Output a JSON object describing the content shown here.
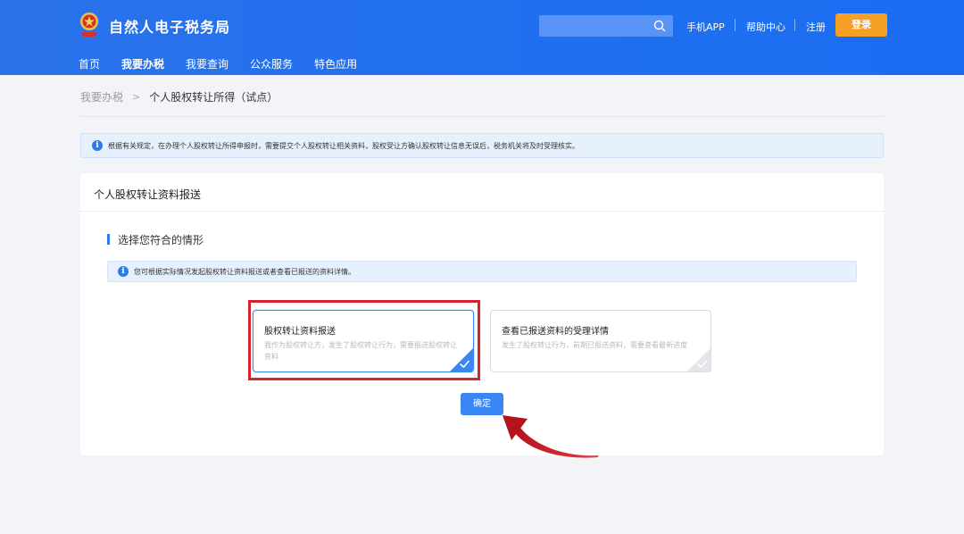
{
  "header": {
    "site_title": "自然人电子税务局",
    "search": {
      "placeholder": ""
    },
    "links": {
      "mobile_app": "手机APP",
      "help_center": "帮助中心",
      "register": "注册"
    },
    "login_label": "登录"
  },
  "nav": {
    "items": [
      {
        "label": "首页",
        "active": false
      },
      {
        "label": "我要办税",
        "active": true
      },
      {
        "label": "我要查询",
        "active": false
      },
      {
        "label": "公众服务",
        "active": false
      },
      {
        "label": "特色应用",
        "active": false
      }
    ]
  },
  "breadcrumb": {
    "home": "我要办税",
    "current": "个人股权转让所得（试点）"
  },
  "notice": {
    "text": "根据有关规定，在办理个人股权转让所得申报时，需要提交个人股权转让相关资料，股权受让方确认股权转让信息无误后，税务机关将及时受理核实。"
  },
  "card": {
    "title": "个人股权转让资料报送",
    "section_title": "选择您符合的情形",
    "inner_notice": "您可根据实际情况发起股权转让资料报送或者查看已报送的资料详情。",
    "options": [
      {
        "title": "股权转让资料报送",
        "desc": "我作为股权转让方，发生了股权转让行为，需要报送股权转让资料",
        "selected": true
      },
      {
        "title": "查看已报送资料的受理详情",
        "desc": "发生了股权转让行为，前期已报送资料，需要查看最新进度",
        "selected": false
      }
    ],
    "confirm_label": "确定"
  },
  "colors": {
    "primary": "#2f7be8",
    "header": "#1f6ff0",
    "login": "#f5a023",
    "highlight": "#d7232f"
  }
}
